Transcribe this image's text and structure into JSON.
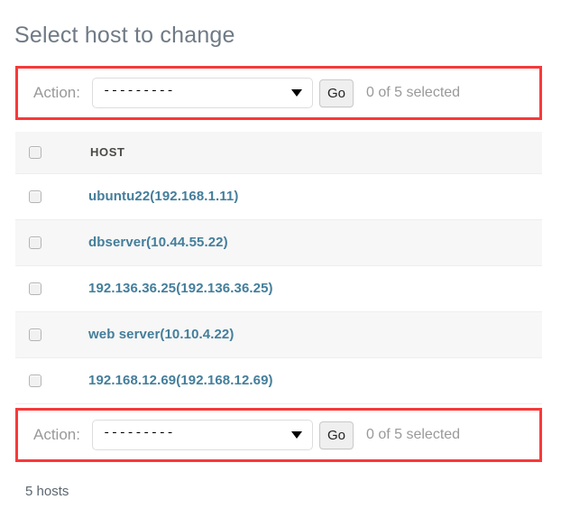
{
  "page": {
    "title": "Select host to change",
    "result_count": "5 hosts"
  },
  "colors": {
    "highlight": "#f8393a",
    "link": "#447e9b",
    "title": "#6f7a85",
    "row_stripe": "#f7f7f7",
    "header_bg": "#f6f6f6"
  },
  "actions": {
    "label": "Action:",
    "select_value": "---------",
    "select_options": [
      "---------"
    ],
    "go_label": "Go",
    "selected_count": "0 of 5 selected"
  },
  "table": {
    "columns": [
      "HOST"
    ],
    "rows": [
      {
        "host": "ubuntu22(192.168.1.11)"
      },
      {
        "host": "dbserver(10.44.55.22)"
      },
      {
        "host": "192.136.36.25(192.136.36.25)"
      },
      {
        "host": "web server(10.10.4.22)"
      },
      {
        "host": "192.168.12.69(192.168.12.69)"
      }
    ]
  }
}
